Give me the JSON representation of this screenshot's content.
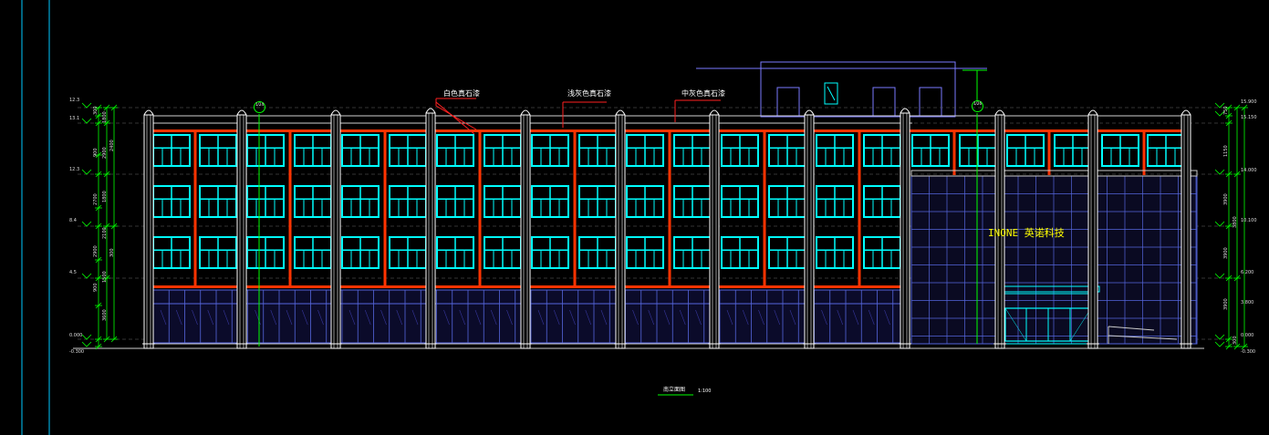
{
  "colors": {
    "background": "#000000",
    "window": "#00ffff",
    "column": "#ffffff",
    "accent": "#ff3300",
    "glass": "#3838a0",
    "grid": "#5566dd",
    "dimension": "#00ff00",
    "sign": "#ffff00",
    "guide": "#00ffff"
  },
  "material_labels": [
    "白色真石漆",
    "浅灰色真石漆",
    "中灰色真石漆"
  ],
  "sign_text": "INONE 英诺科技",
  "drawing_title": "南立面图",
  "drawing_scale": "1:100",
  "axis_bubbles": [
    "1/24",
    "1/26"
  ],
  "left_elevations": [
    "12.3",
    "13.1",
    "12.3",
    "8.4",
    "4.5",
    "0.000",
    "-0.300"
  ],
  "right_elevations": [
    "15.900",
    "15.150",
    "14.000",
    "10.100",
    "6.200",
    "3.800",
    "0.000",
    "-0.300"
  ],
  "left_dimensions": [
    "300",
    "900",
    "2700",
    "2900",
    "900",
    "1800",
    "2900",
    "1800",
    "2100",
    "1500",
    "3600",
    "2400",
    "300"
  ],
  "right_dimensions": [
    "750",
    "1150",
    "3900",
    "3900",
    "3900",
    "3800",
    "300"
  ]
}
